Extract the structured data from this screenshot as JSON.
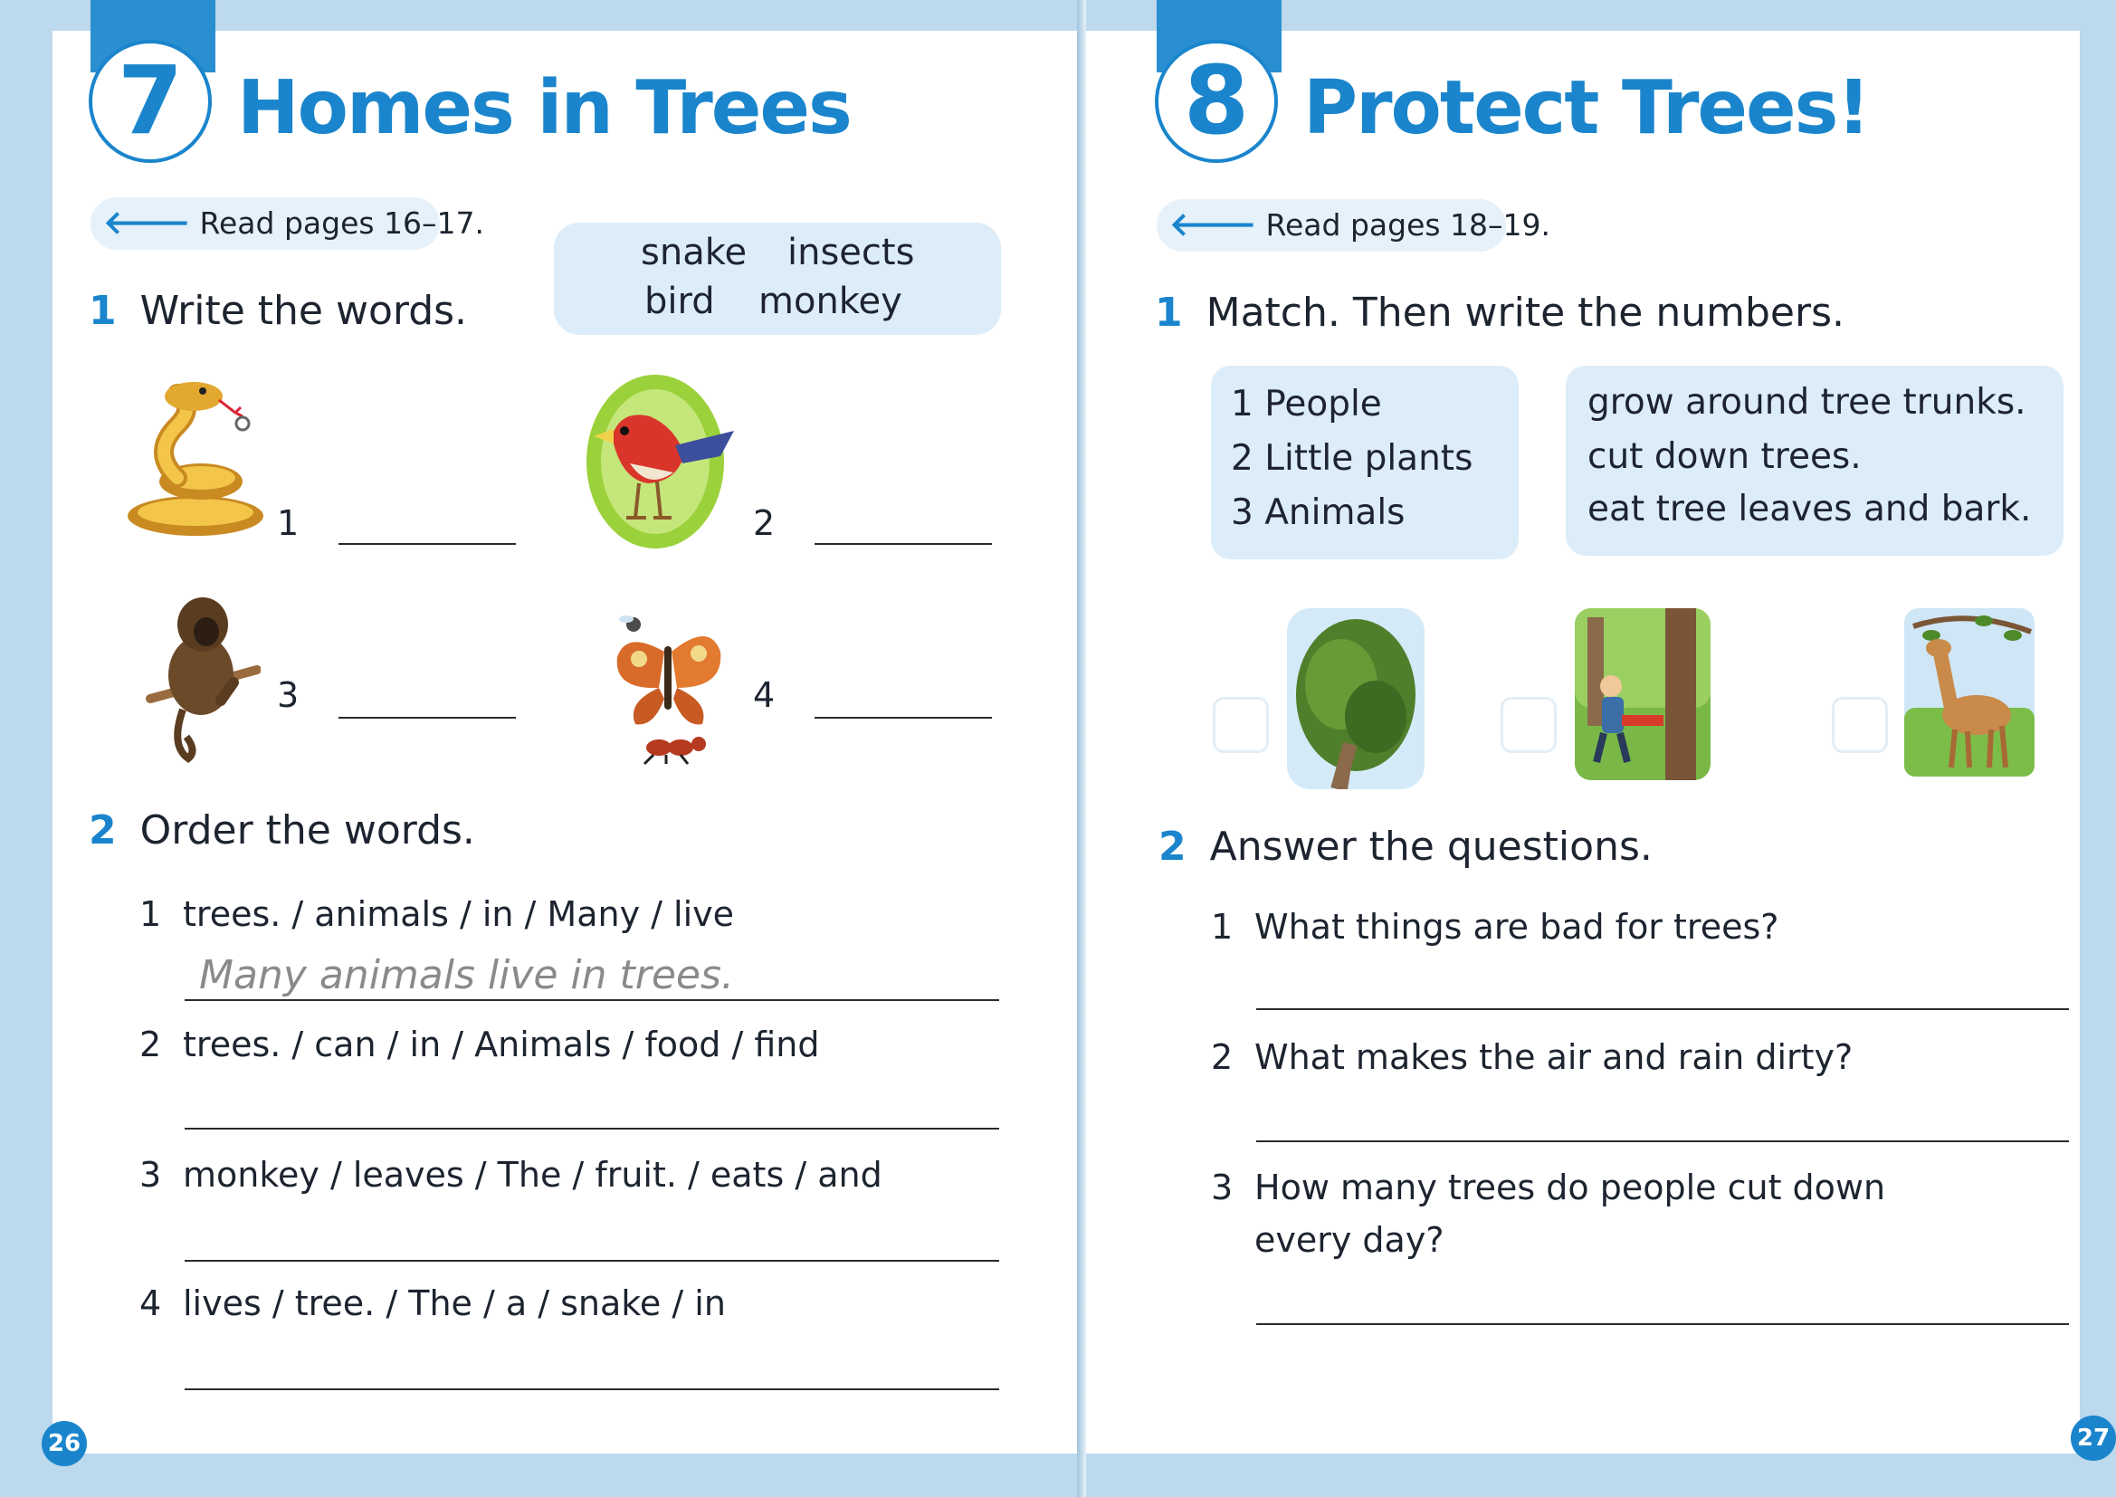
{
  "left": {
    "unit_number": "7",
    "unit_title": "Homes in Trees",
    "read_pages": "Read pages 16–17.",
    "word_bank": [
      "snake",
      "insects",
      "bird",
      "monkey"
    ],
    "ex1": {
      "number": "1",
      "instruction": "Write the words.",
      "labels": [
        "1",
        "2",
        "3",
        "4"
      ]
    },
    "ex2": {
      "number": "2",
      "instruction": "Order the words.",
      "items": [
        {
          "n": "1",
          "text": "trees. / animals / in / Many / live"
        },
        {
          "n": "2",
          "text": "trees. / can / in / Animals / food / find"
        },
        {
          "n": "3",
          "text": "monkey / leaves / The / fruit. / eats / and"
        },
        {
          "n": "4",
          "text": "lives / tree. / The / a / snake / in"
        }
      ],
      "example_answer": "Many animals live in trees."
    },
    "page_number": "26"
  },
  "right": {
    "unit_number": "8",
    "unit_title": "Protect Trees!",
    "read_pages": "Read pages 18–19.",
    "ex1": {
      "number": "1",
      "instruction": "Match. Then write the numbers.",
      "subjects": [
        "1  People",
        "2  Little plants",
        "3  Animals"
      ],
      "predicates": [
        "grow around tree trunks.",
        "cut down trees.",
        "eat tree leaves and bark."
      ]
    },
    "ex2": {
      "number": "2",
      "instruction": "Answer the questions.",
      "questions": [
        {
          "n": "1",
          "text": "What things are bad for trees?"
        },
        {
          "n": "2",
          "text": "What makes the air and rain dirty?"
        },
        {
          "n": "3",
          "text": "How many trees do people cut down",
          "text2": "every day?"
        }
      ]
    },
    "page_number": "27"
  },
  "colors": {
    "accent": "#1a85cc",
    "box": "#dcedf9",
    "frame": "#bcd9ee"
  },
  "icons": [
    "arrow-left-icon",
    "snake-icon",
    "bird-icon",
    "monkey-icon",
    "insects-icon",
    "vine-tree-icon",
    "lumberjack-icon",
    "deer-icon"
  ]
}
